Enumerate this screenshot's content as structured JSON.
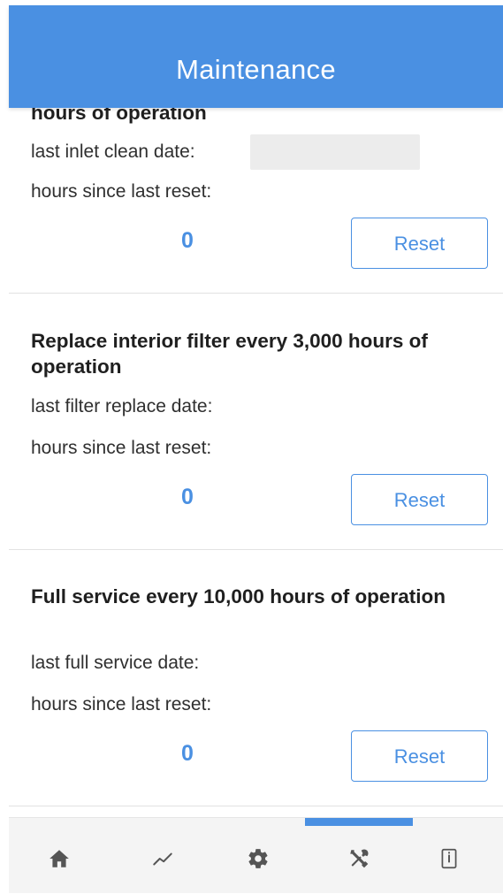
{
  "colors": {
    "accent": "#4a90e2",
    "tab_icon": "#555555"
  },
  "header": {
    "title": "Maintenance"
  },
  "sections": [
    {
      "title": "hours of operation",
      "date_label": "last inlet clean date:",
      "hours_label": "hours since last reset:",
      "hours_value": "0",
      "reset_label": "Reset"
    },
    {
      "title": "Replace interior filter every 3,000 hours of operation",
      "date_label": "last filter replace date:",
      "hours_label": "hours since last reset:",
      "hours_value": "0",
      "reset_label": "Reset"
    },
    {
      "title": "Full service every 10,000 hours of operation",
      "date_label": "last full service date:",
      "hours_label": "hours since last reset:",
      "hours_value": "0",
      "reset_label": "Reset"
    }
  ],
  "tabbar": {
    "active_index": 3,
    "tabs": [
      {
        "icon": "home-icon"
      },
      {
        "icon": "trend-chart-icon"
      },
      {
        "icon": "gear-icon"
      },
      {
        "icon": "tools-icon"
      },
      {
        "icon": "info-device-icon"
      }
    ]
  }
}
